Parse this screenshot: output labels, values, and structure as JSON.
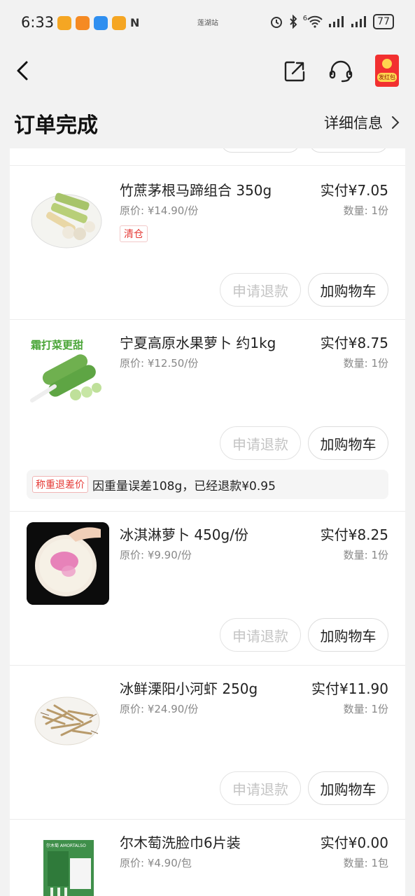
{
  "status_bar": {
    "time": "6:33",
    "center_label": "莲湖站",
    "network": "6",
    "battery": "77"
  },
  "header": {
    "title": "订单完成",
    "detail_label": "详细信息",
    "redpacket_label": "发红包"
  },
  "colors": {
    "accent_red": "#e53935",
    "redpacket": "#f23030",
    "background": "#f2f2f2"
  },
  "items": [
    {
      "name": "竹蔗茅根马蹄组合 350g",
      "original_price": "原价: ¥14.90/份",
      "paid": "实付¥7.05",
      "quantity": "数量: 1份",
      "tag": "清仓",
      "refund_label": "申请退款",
      "cart_label": "加购物车"
    },
    {
      "name": "宁夏高原水果萝卜 约1kg",
      "original_price": "原价: ¥12.50/份",
      "paid": "实付¥8.75",
      "quantity": "数量: 1份",
      "refund_label": "申请退款",
      "cart_label": "加购物车",
      "image_text": "霜打菜更甜",
      "notice_tag": "称重退差价",
      "notice_text": "因重量误差108g，已经退款¥0.95"
    },
    {
      "name": "冰淇淋萝卜 450g/份",
      "original_price": "原价: ¥9.90/份",
      "paid": "实付¥8.25",
      "quantity": "数量: 1份",
      "refund_label": "申请退款",
      "cart_label": "加购物车"
    },
    {
      "name": "冰鲜溧阳小河虾 250g",
      "original_price": "原价: ¥24.90/份",
      "paid": "实付¥11.90",
      "quantity": "数量: 1份",
      "refund_label": "申请退款",
      "cart_label": "加购物车"
    },
    {
      "name": "尔木萄洗脸巾6片装",
      "original_price": "原价: ¥4.90/包",
      "paid": "实付¥0.00",
      "quantity": "数量: 1包",
      "image_text": "尔木萄 AMORTALSO"
    }
  ]
}
